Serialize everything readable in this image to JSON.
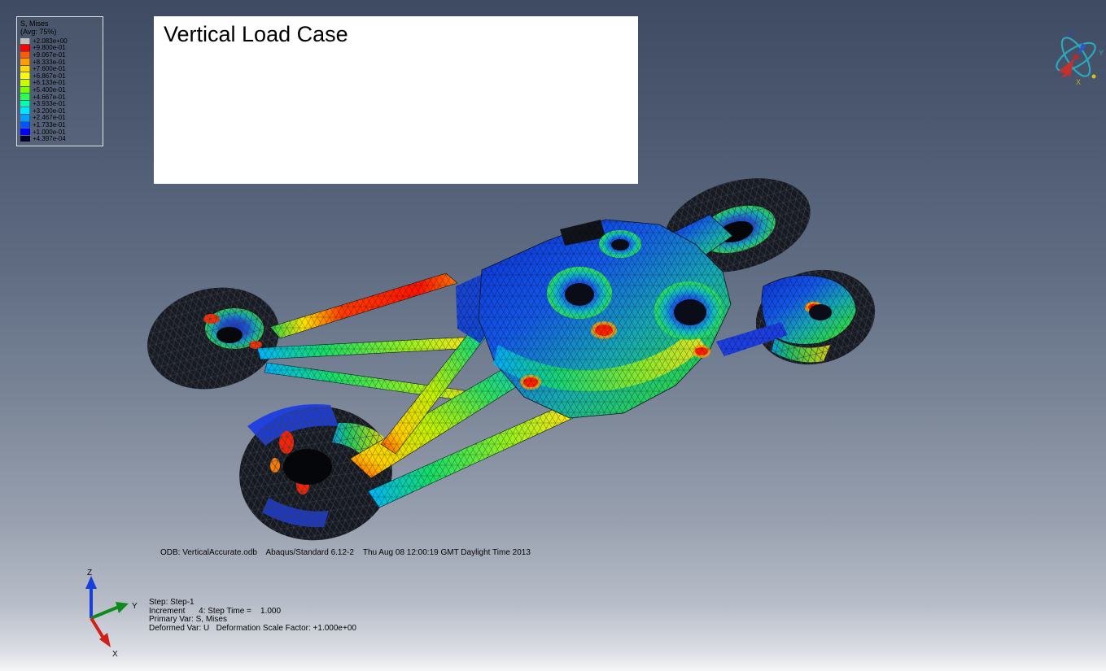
{
  "legend": {
    "title": "S, Mises",
    "subtitle": "(Avg: 75%)",
    "entries": [
      {
        "color": "#bfbfbf",
        "value": "+2.083e+00"
      },
      {
        "color": "#ff0000",
        "value": "+9.800e-01"
      },
      {
        "color": "#ff5a00",
        "value": "+9.067e-01"
      },
      {
        "color": "#ff9c00",
        "value": "+8.333e-01"
      },
      {
        "color": "#ffd800",
        "value": "+7.600e-01"
      },
      {
        "color": "#fffa00",
        "value": "+6.867e-01"
      },
      {
        "color": "#c8ff00",
        "value": "+6.133e-01"
      },
      {
        "color": "#78ff00",
        "value": "+5.400e-01"
      },
      {
        "color": "#28ff4e",
        "value": "+4.667e-01"
      },
      {
        "color": "#00ffb4",
        "value": "+3.933e-01"
      },
      {
        "color": "#00e6ff",
        "value": "+3.200e-01"
      },
      {
        "color": "#00a0ff",
        "value": "+2.467e-01"
      },
      {
        "color": "#0055ff",
        "value": "+1.733e-01"
      },
      {
        "color": "#0000ff",
        "value": "+1.000e-01"
      },
      {
        "color": "#000028",
        "value": "+4.397e-04"
      }
    ]
  },
  "annotation": {
    "title": "Vertical Load Case"
  },
  "status": {
    "odb_line": "ODB: VerticalAccurate.odb    Abaqus/Standard 6.12-2    Thu Aug 08 12:00:19 GMT Daylight Time 2013",
    "step_lines": [
      "Step: Step-1",
      "Increment      4: Step Time =    1.000",
      "Primary Var: S, Mises",
      "Deformed Var: U   Deformation Scale Factor: +1.000e+00"
    ]
  },
  "triad": {
    "x": "X",
    "y": "Y",
    "z": "Z"
  },
  "compass": {
    "x": "X",
    "y": "Y",
    "z": "Z"
  }
}
